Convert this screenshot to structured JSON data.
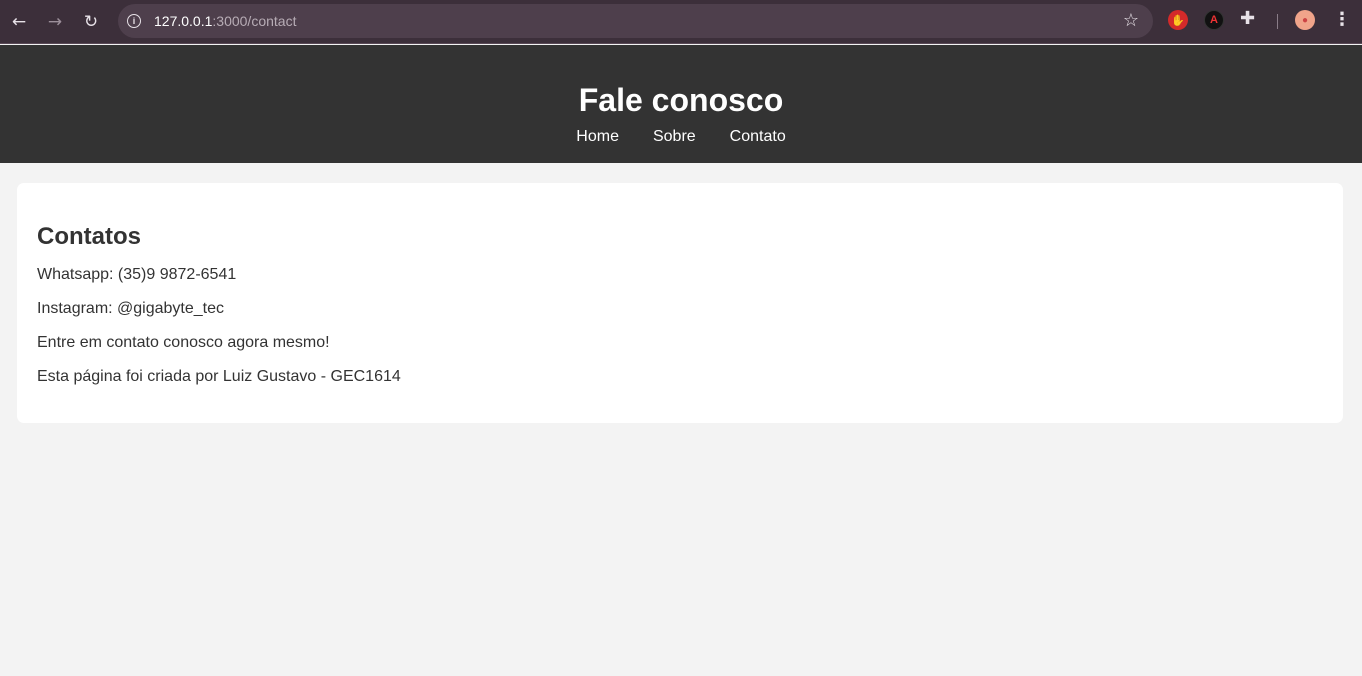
{
  "browser": {
    "url_host": "127.0.0.1",
    "url_path": ":3000/contact",
    "icons": [
      "back-arrow-icon",
      "forward-arrow-icon",
      "reload-icon",
      "site-info-icon",
      "star-icon",
      "extension-icon",
      "puzzle-icon",
      "profile-avatar",
      "more-menu-icon"
    ]
  },
  "header": {
    "title": "Fale conosco",
    "nav": [
      "Home",
      "Sobre",
      "Contato"
    ]
  },
  "contacts": {
    "heading": "Contatos",
    "whatsapp": "Whatsapp: (35)9 9872-6541",
    "instagram": "Instagram: @gigabyte_tec",
    "cta": "Entre em contato conosco agora mesmo!",
    "credit": "Esta página foi criada por Luiz Gustavo - GEC1614"
  },
  "colors": {
    "header_bg": "#333333",
    "page_bg": "#f3f3f3",
    "card_bg": "#ffffff",
    "browser_bg": "#3c2f3a"
  }
}
